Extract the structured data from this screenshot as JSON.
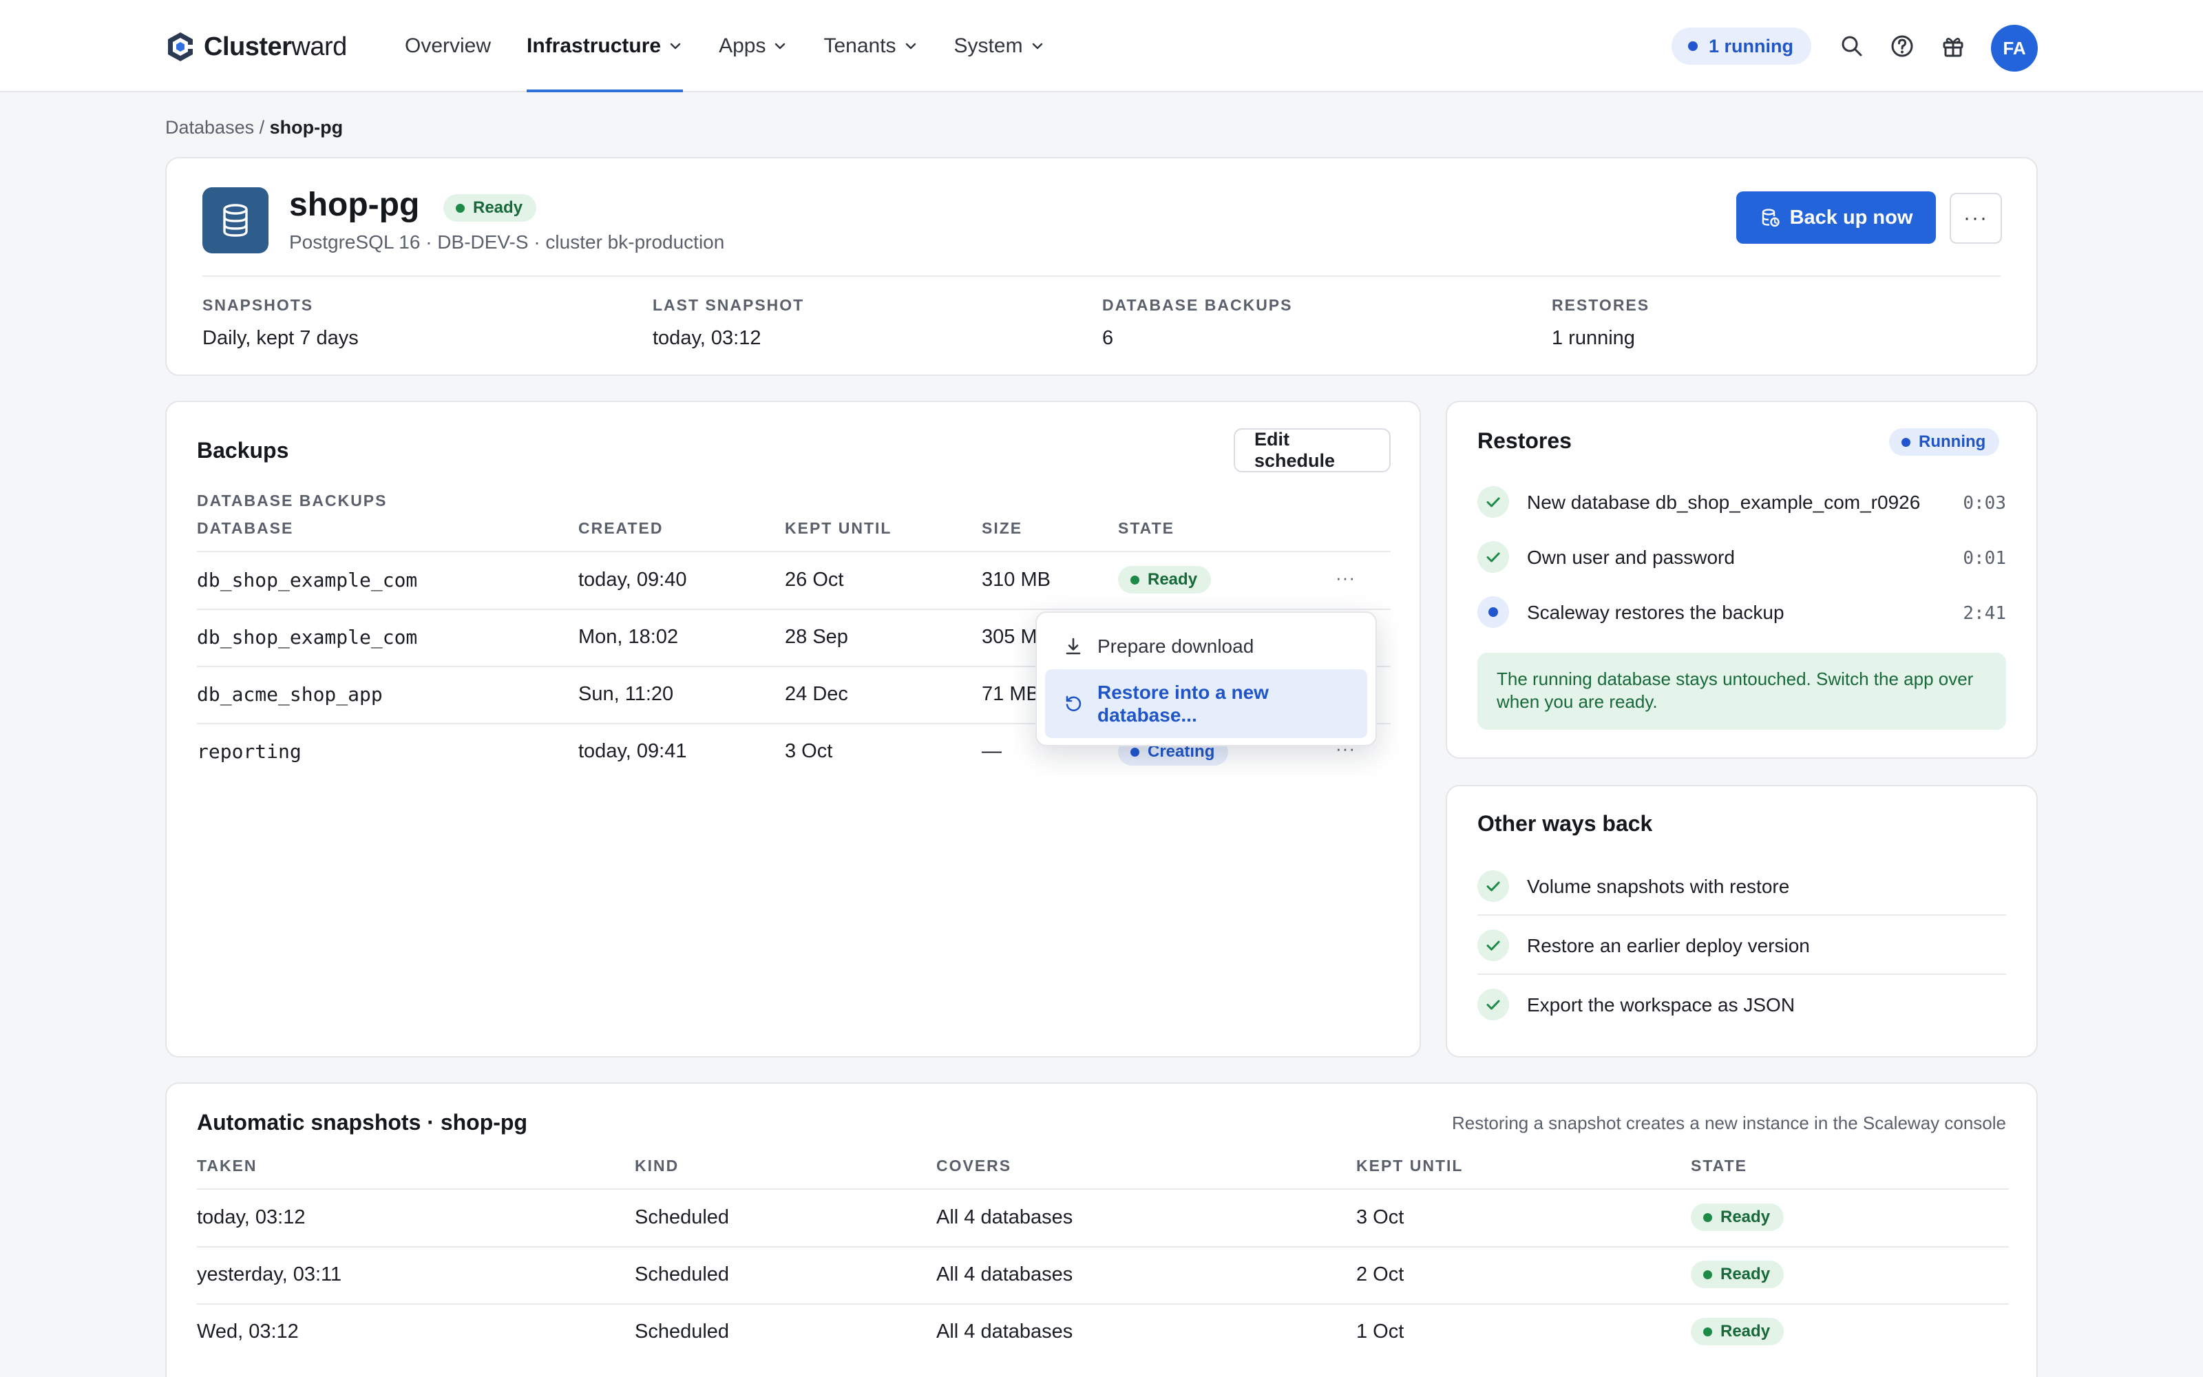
{
  "brand": {
    "name_bold": "Cluster",
    "name_light": "ward"
  },
  "nav": {
    "items": [
      {
        "label": "Overview"
      },
      {
        "label": "Infrastructure"
      },
      {
        "label": "Apps"
      },
      {
        "label": "Tenants"
      },
      {
        "label": "System"
      }
    ],
    "active": "Infrastructure"
  },
  "top": {
    "running_pill": "1 running",
    "avatar_initials": "FA"
  },
  "breadcrumb": {
    "parent": "Databases",
    "separator": "/",
    "current": "shop-pg"
  },
  "database": {
    "name": "shop-pg",
    "status": "Ready",
    "subtitle": "PostgreSQL 16 · DB-DEV-S · cluster bk-production",
    "backup_button": "Back up now",
    "more_button": "···"
  },
  "stats": [
    {
      "label": "SNAPSHOTS",
      "value": "Daily, kept 7 days"
    },
    {
      "label": "LAST SNAPSHOT",
      "value": "today, 03:12"
    },
    {
      "label": "DATABASE BACKUPS",
      "value": "6"
    },
    {
      "label": "RESTORES",
      "value": "1 running"
    }
  ],
  "backups": {
    "title": "Backups",
    "edit_button": "Edit schedule",
    "section_label": "DATABASE BACKUPS",
    "columns": [
      "DATABASE",
      "CREATED",
      "KEPT UNTIL",
      "SIZE",
      "STATE"
    ],
    "rows": [
      {
        "database": "db_shop_example_com",
        "created": "today, 09:40",
        "kept_until": "26 Oct",
        "size": "310 MB",
        "state": "Ready"
      },
      {
        "database": "db_shop_example_com",
        "created": "Mon, 18:02",
        "kept_until": "28 Sep",
        "size": "305 M",
        "state": ""
      },
      {
        "database": "db_acme_shop_app",
        "created": "Sun, 11:20",
        "kept_until": "24 Dec",
        "size": "71 MB",
        "state": ""
      },
      {
        "database": "reporting",
        "created": "today, 09:41",
        "kept_until": "3 Oct",
        "size": "—",
        "state": "Creating"
      }
    ],
    "row_more": "···",
    "menu": {
      "items": [
        {
          "label": "Prepare download",
          "icon": "download-icon"
        },
        {
          "label": "Restore into a new database...",
          "icon": "restore-icon"
        }
      ]
    }
  },
  "restores": {
    "title": "Restores",
    "status": "Running",
    "steps": [
      {
        "label": "New database db_shop_example_com_r0926",
        "time": "0:03",
        "state": "done"
      },
      {
        "label": "Own user and password",
        "time": "0:01",
        "state": "done"
      },
      {
        "label": "Scaleway restores the backup",
        "time": "2:41",
        "state": "active"
      }
    ],
    "note": "The running database stays untouched. Switch the app over when you are ready."
  },
  "other_ways": {
    "title": "Other ways back",
    "items": [
      {
        "label": "Volume snapshots with restore"
      },
      {
        "label": "Restore an earlier deploy version"
      },
      {
        "label": "Export the workspace as JSON"
      }
    ]
  },
  "snapshots": {
    "title": "Automatic snapshots · shop-pg",
    "hint": "Restoring a snapshot creates a new instance in the Scaleway console",
    "columns": [
      "TAKEN",
      "KIND",
      "COVERS",
      "KEPT UNTIL",
      "STATE"
    ],
    "rows": [
      {
        "taken": "today, 03:12",
        "kind": "Scheduled",
        "covers": "All 4 databases",
        "kept_until": "3 Oct",
        "state": "Ready"
      },
      {
        "taken": "yesterday, 03:11",
        "kind": "Scheduled",
        "covers": "All 4 databases",
        "kept_until": "2 Oct",
        "state": "Ready"
      },
      {
        "taken": "Wed, 03:12",
        "kind": "Scheduled",
        "covers": "All 4 databases",
        "kept_until": "1 Oct",
        "state": "Ready"
      }
    ]
  },
  "colors": {
    "accent": "#2464db",
    "ready": "#17693a",
    "ready_bg": "#e3f3e8",
    "running": "#1f55c7",
    "running_bg": "#e5ecfb"
  }
}
